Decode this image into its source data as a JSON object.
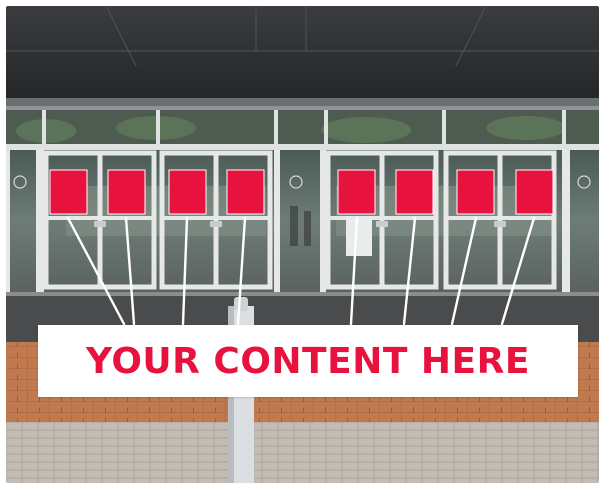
{
  "banner": {
    "text": "YOUR CONTENT HERE"
  },
  "colors": {
    "accent": "#e8123f",
    "banner_bg": "#ffffff",
    "canopy": "#2f3134",
    "pavement": "#b7b1a9",
    "brick": "#b06a42"
  },
  "placeholders": [
    {
      "name": "ad-placeholder-1"
    },
    {
      "name": "ad-placeholder-2"
    },
    {
      "name": "ad-placeholder-3"
    },
    {
      "name": "ad-placeholder-4"
    },
    {
      "name": "ad-placeholder-5"
    },
    {
      "name": "ad-placeholder-6"
    },
    {
      "name": "ad-placeholder-7"
    },
    {
      "name": "ad-placeholder-8"
    }
  ]
}
